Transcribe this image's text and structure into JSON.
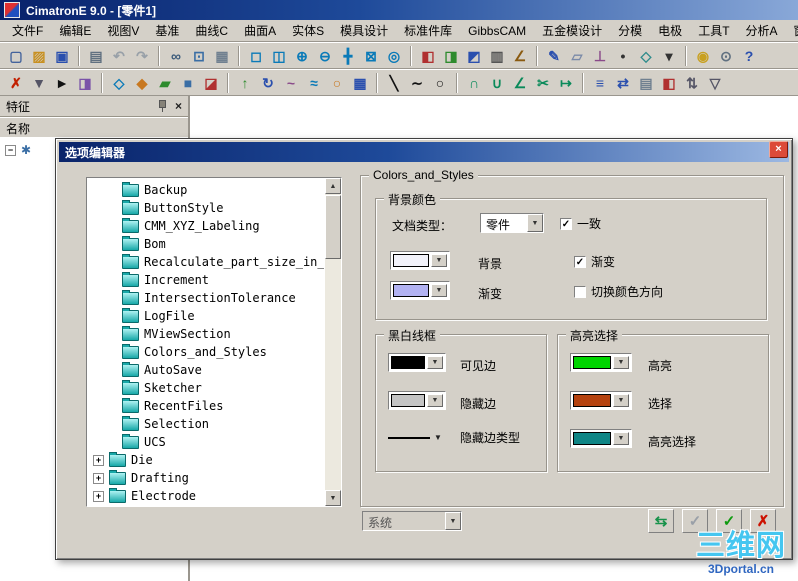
{
  "titlebar": {
    "title": "CimatronE 9.0 - [零件1]"
  },
  "menu": {
    "items": [
      {
        "label": "文件F"
      },
      {
        "label": "编辑E"
      },
      {
        "label": "视图V"
      },
      {
        "label": "基准"
      },
      {
        "label": "曲线C"
      },
      {
        "label": "曲面A"
      },
      {
        "label": "实体S"
      },
      {
        "label": "模具设计"
      },
      {
        "label": "标准件库"
      },
      {
        "label": "GibbsCAM"
      },
      {
        "label": "五金模设计"
      },
      {
        "label": "分模"
      },
      {
        "label": "电极"
      },
      {
        "label": "工具T"
      },
      {
        "label": "分析A"
      },
      {
        "label": "窗口"
      }
    ]
  },
  "toolbar1": {
    "items": [
      {
        "name": "new-file-icon",
        "glyph": "▢",
        "fg": "#44639c"
      },
      {
        "name": "open-folder-icon",
        "glyph": "▨",
        "fg": "#c89020"
      },
      {
        "name": "save-icon",
        "glyph": "▣",
        "fg": "#2a4fae"
      },
      {
        "sep": true
      },
      {
        "name": "print-icon",
        "glyph": "▤",
        "fg": "#607080"
      },
      {
        "name": "undo-icon",
        "glyph": "↶",
        "fg": "#98a0a8"
      },
      {
        "name": "redo-icon",
        "glyph": "↷",
        "fg": "#98a0a8"
      },
      {
        "sep": true
      },
      {
        "name": "eyeglasses-icon",
        "glyph": "∞",
        "fg": "#3a5a7a"
      },
      {
        "name": "monitor-icon",
        "glyph": "⊡",
        "fg": "#3a6ea5"
      },
      {
        "name": "datatable-icon",
        "glyph": "▦",
        "fg": "#708090"
      },
      {
        "sep": true
      },
      {
        "name": "select-window-icon",
        "glyph": "◻",
        "fg": "#0a7ab8"
      },
      {
        "name": "zoom-window-icon",
        "glyph": "◫",
        "fg": "#0a7ab8"
      },
      {
        "name": "zoom-in-icon",
        "glyph": "⊕",
        "fg": "#0a7ab8"
      },
      {
        "name": "zoom-out-icon",
        "glyph": "⊖",
        "fg": "#0a7ab8"
      },
      {
        "name": "pan-icon",
        "glyph": "╋",
        "fg": "#0a7ab8"
      },
      {
        "name": "zoom-fit-icon",
        "glyph": "⊠",
        "fg": "#0a7ab8"
      },
      {
        "name": "screen-refresh-icon",
        "glyph": "◎",
        "fg": "#0a7ab8"
      },
      {
        "sep": true
      },
      {
        "name": "view-cube-red-icon",
        "glyph": "◧",
        "fg": "#b03030"
      },
      {
        "name": "view-cube-green-icon",
        "glyph": "◨",
        "fg": "#2e8b2e"
      },
      {
        "name": "view-cube-blue-icon",
        "glyph": "◩",
        "fg": "#2a4fae"
      },
      {
        "name": "calculator-icon",
        "glyph": "▥",
        "fg": "#555555"
      },
      {
        "name": "measure-icon",
        "glyph": "∠",
        "fg": "#8a5a10"
      },
      {
        "sep": true
      },
      {
        "name": "sketch-pencil-icon",
        "glyph": "✎",
        "fg": "#2a4fae"
      },
      {
        "name": "plane-icon",
        "glyph": "▱",
        "fg": "#7a8aa8"
      },
      {
        "name": "axis-icon",
        "glyph": "⊥",
        "fg": "#8a4a8a"
      },
      {
        "name": "point-icon",
        "glyph": "•",
        "fg": "#333333"
      },
      {
        "name": "cube-icon",
        "glyph": "◇",
        "fg": "#2e8b8b"
      },
      {
        "name": "more-dropdown-icon",
        "glyph": "▾",
        "fg": "#333333"
      },
      {
        "sep": true
      },
      {
        "name": "lamp-icon",
        "glyph": "◉",
        "fg": "#c8a020"
      },
      {
        "name": "mouse-icon",
        "glyph": "⊙",
        "fg": "#607080"
      },
      {
        "name": "help-icon",
        "glyph": "?",
        "fg": "#2a4fae"
      }
    ]
  },
  "toolbar2": {
    "items": [
      {
        "name": "delete-icon",
        "glyph": "✗",
        "fg": "#c22000"
      },
      {
        "name": "selection-filter-icon",
        "glyph": "▼",
        "fg": "#555566"
      },
      {
        "name": "pick-arrow-icon",
        "glyph": "►",
        "fg": "#111111"
      },
      {
        "name": "color-fill-icon",
        "glyph": "◨",
        "fg": "#7a52a8"
      },
      {
        "sep": true
      },
      {
        "name": "wireframe-icon",
        "glyph": "◇",
        "fg": "#0a7ab8"
      },
      {
        "name": "shaded-icon",
        "glyph": "◆",
        "fg": "#c87820"
      },
      {
        "name": "surface-icon",
        "glyph": "▰",
        "fg": "#2e8b2e"
      },
      {
        "name": "solid-icon",
        "glyph": "■",
        "fg": "#3a6ea5"
      },
      {
        "name": "section-view-icon",
        "glyph": "◪",
        "fg": "#b03030"
      },
      {
        "sep": true
      },
      {
        "name": "extrude-icon",
        "glyph": "↑",
        "fg": "#2e8b2e"
      },
      {
        "name": "revolve-icon",
        "glyph": "↻",
        "fg": "#2a4fae"
      },
      {
        "name": "sweep-icon",
        "glyph": "~",
        "fg": "#8a4a8a"
      },
      {
        "name": "loft-icon",
        "glyph": "≈",
        "fg": "#0a7ab8"
      },
      {
        "name": "shell-icon",
        "glyph": "○",
        "fg": "#c87820"
      },
      {
        "name": "pattern-icon",
        "glyph": "▦",
        "fg": "#2a4fae"
      },
      {
        "sep": true
      },
      {
        "name": "line-icon",
        "glyph": "╲",
        "fg": "#111111"
      },
      {
        "name": "polyline-icon",
        "glyph": "∼",
        "fg": "#111111"
      },
      {
        "name": "circle-icon",
        "glyph": "○",
        "fg": "#111111"
      },
      {
        "sep": true
      },
      {
        "name": "arc-icon",
        "glyph": "∩",
        "fg": "#0a8a5a"
      },
      {
        "name": "fillet-icon",
        "glyph": "∪",
        "fg": "#0a8a5a"
      },
      {
        "name": "chamfer-icon",
        "glyph": "∠",
        "fg": "#0a8a5a"
      },
      {
        "name": "trim-icon",
        "glyph": "✂",
        "fg": "#0a8a5a"
      },
      {
        "name": "extend-icon",
        "glyph": "↦",
        "fg": "#0a8a5a"
      },
      {
        "sep": true
      },
      {
        "name": "offset-icon",
        "glyph": "≡",
        "fg": "#2a4fae"
      },
      {
        "name": "mirror-icon",
        "glyph": "⇄",
        "fg": "#2a4fae"
      },
      {
        "name": "layers-icon",
        "glyph": "▤",
        "fg": "#708090"
      },
      {
        "name": "palette-icon",
        "glyph": "◧",
        "fg": "#b03030"
      },
      {
        "name": "sort-icon",
        "glyph": "⇅",
        "fg": "#555566"
      },
      {
        "name": "filter-funnel-icon",
        "glyph": "▽",
        "fg": "#555566"
      }
    ]
  },
  "feature_panel": {
    "title": "特征",
    "column_header": "名称"
  },
  "dialog": {
    "title": "选项编辑器",
    "tree": {
      "items": [
        {
          "label": "Backup",
          "cls": "lvl1",
          "plus": false
        },
        {
          "label": "ButtonStyle",
          "cls": "lvl1",
          "plus": false
        },
        {
          "label": "CMM_XYZ_Labeling",
          "cls": "lvl1",
          "plus": false
        },
        {
          "label": "Bom",
          "cls": "lvl1",
          "plus": false
        },
        {
          "label": "Recalculate_part_size_in_save",
          "cls": "lvl1",
          "plus": false
        },
        {
          "label": "Increment",
          "cls": "lvl1",
          "plus": false
        },
        {
          "label": "IntersectionTolerance",
          "cls": "lvl1",
          "plus": false
        },
        {
          "label": "LogFile",
          "cls": "lvl1",
          "plus": false
        },
        {
          "label": "MViewSection",
          "cls": "lvl1",
          "plus": false
        },
        {
          "label": "Colors_and_Styles",
          "cls": "lvl1",
          "plus": false
        },
        {
          "label": "AutoSave",
          "cls": "lvl1",
          "plus": false
        },
        {
          "label": "Sketcher",
          "cls": "lvl1",
          "plus": false
        },
        {
          "label": "RecentFiles",
          "cls": "lvl1",
          "plus": false
        },
        {
          "label": "Selection",
          "cls": "lvl1",
          "plus": false
        },
        {
          "label": "UCS",
          "cls": "lvl1",
          "plus": false
        },
        {
          "label": "Die",
          "cls": "lvl0",
          "plus": true
        },
        {
          "label": "Drafting",
          "cls": "lvl0",
          "plus": true
        },
        {
          "label": "Electrode",
          "cls": "lvl0",
          "plus": true
        }
      ]
    },
    "outer_group_title": "Colors_and_Styles",
    "bg_group": {
      "title": "背景颜色",
      "doc_type_label": "文档类型：",
      "doc_type_value": "零件",
      "consistent_label": "一致",
      "consistent_checked": true,
      "background_swatch": "#f2f2fa",
      "background_label": "背景",
      "gradient_check_label": "渐变",
      "gradient_checked": true,
      "gradient_swatch": "#b2b2f2",
      "gradient_label": "渐变",
      "flip_label": "切换颜色方向",
      "flip_checked": false
    },
    "wire_group": {
      "title": "黑白线框",
      "visible_swatch": "#000000",
      "visible_label": "可见边",
      "hidden_swatch": "#c4c4c4",
      "hidden_label": "隐藏边",
      "hidden_type_label": "隐藏边类型"
    },
    "highlight_group": {
      "title": "高亮选择",
      "highlight_swatch": "#00d400",
      "highlight_label": "高亮",
      "select_swatch": "#b5420f",
      "select_label": "选择",
      "hl_select_swatch": "#0f8585",
      "hl_select_label": "高亮选择"
    },
    "footer": {
      "scope_value": "系统",
      "buttons": [
        {
          "name": "restore-defaults-button",
          "glyph": "⇆",
          "fg": "#18924a"
        },
        {
          "name": "apply-button",
          "glyph": "✓",
          "fg": "#9aa0a8"
        },
        {
          "name": "ok-button",
          "glyph": "✓",
          "fg": "#0f9a0f"
        },
        {
          "name": "cancel-button",
          "glyph": "✗",
          "fg": "#cc1100"
        }
      ]
    }
  },
  "watermark": {
    "line1": "三维网",
    "line2": "3Dportal.cn"
  }
}
